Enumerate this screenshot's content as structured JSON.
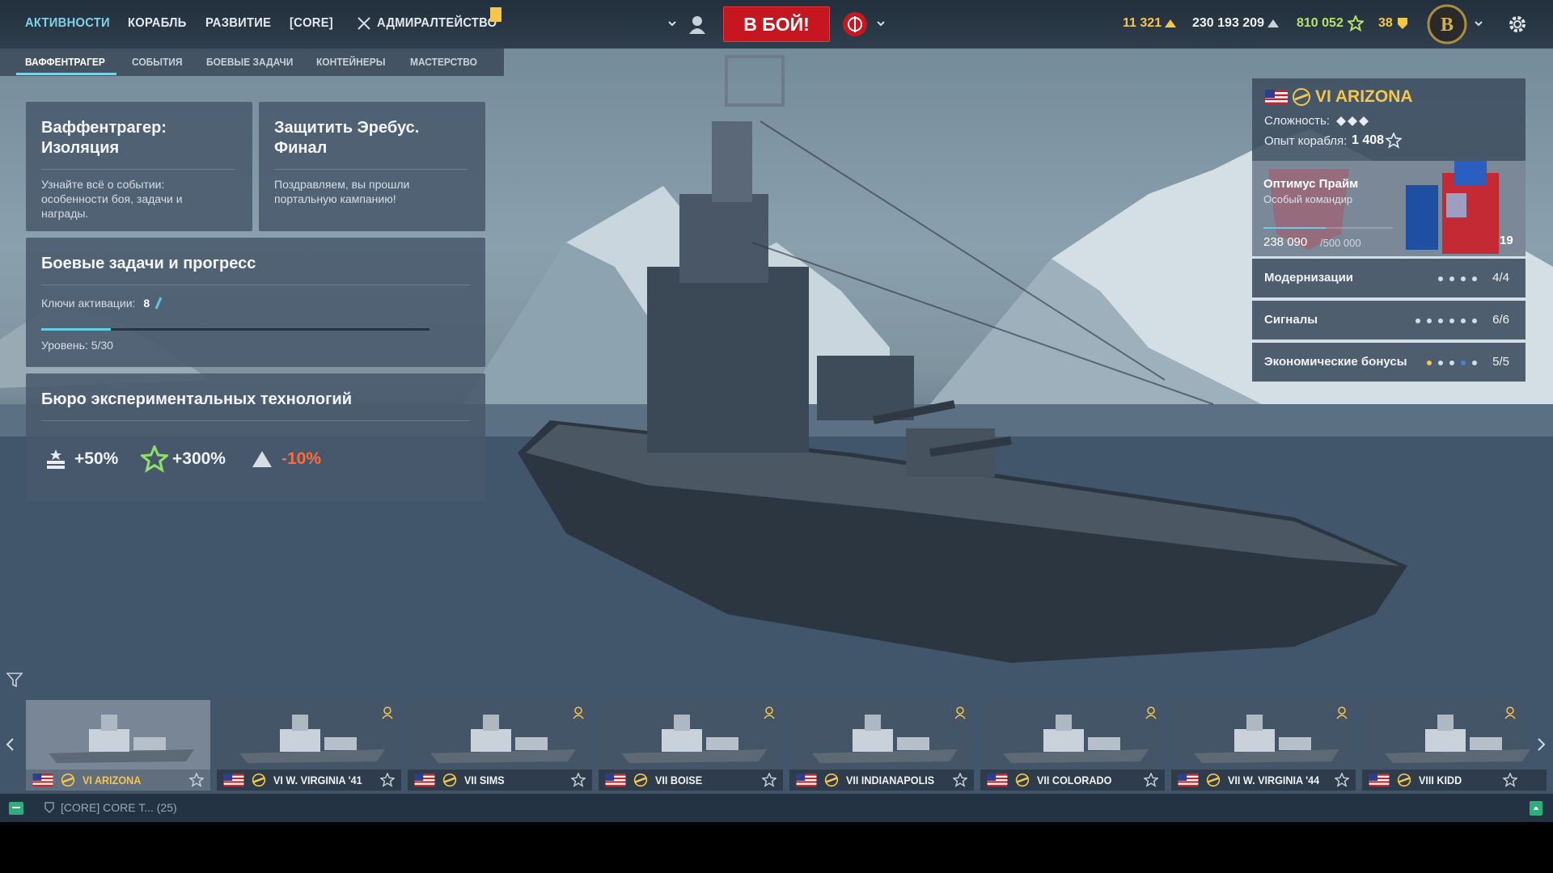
{
  "top_nav": {
    "items": [
      {
        "label": "АКТИВНОСТИ",
        "active": true
      },
      {
        "label": "КОРАБЛЬ"
      },
      {
        "label": "РАЗВИТИЕ"
      },
      {
        "label": "[CORE]"
      },
      {
        "label": "АДМИРАЛТЕЙСТВО"
      }
    ],
    "battle_button": "В БОЙ!",
    "resources": {
      "doubloons": "11 321",
      "credits": "230 193 209",
      "free_xp": "810 052",
      "coal": "38"
    },
    "icons": [
      "crossed-swords-icon",
      "division-icon",
      "battle-mode-icon",
      "clan-emblem-icon",
      "settings-gear-icon"
    ]
  },
  "sub_tabs": [
    {
      "label": "ВАФФЕНТРАГЕР",
      "active": true
    },
    {
      "label": "СОБЫТИЯ"
    },
    {
      "label": "БОЕВЫЕ ЗАДАЧИ"
    },
    {
      "label": "КОНТЕЙНЕРЫ"
    },
    {
      "label": "МАСТЕРСТВО"
    }
  ],
  "cards": {
    "event": {
      "title": "Ваффентрагер: Изоляция",
      "text": "Узнайте всё о событии: особенности боя, задачи и награды."
    },
    "erebus": {
      "title": "Защитить Эребус. Финал",
      "text": "Поздравляем, вы прошли портальную кампанию!"
    },
    "combat_tasks": {
      "title": "Боевые задачи и прогресс",
      "keys_label": "Ключи активации:",
      "keys_value": "8",
      "level_label": "Уровень: 5/30",
      "progress": 0.18
    },
    "bureau": {
      "title": "Бюро экспериментальных технологий",
      "bonus_xp": "+50%",
      "bonus_free_xp": "+300%",
      "bonus_credits": "-10%"
    }
  },
  "ship_panel": {
    "name": "VI ARIZONA",
    "difficulty_label": "Сложность:",
    "xp_label": "Опыт корабля:",
    "xp_value": "1 408",
    "commander_name": "Оптимус Прайм",
    "commander_type": "Особый командир",
    "commander_xp": "238 090",
    "commander_xp_max": "/500 000",
    "commander_level": "19",
    "commander_progress": 0.48,
    "rows": [
      {
        "label": "Модернизации",
        "value": "4/4",
        "dots": 4
      },
      {
        "label": "Сигналы",
        "value": "6/6",
        "dots": 6
      },
      {
        "label": "Экономические бонусы",
        "value": "5/5",
        "dots": 5
      }
    ]
  },
  "carousel": {
    "ships": [
      {
        "name": "VI ARIZONA",
        "selected": true
      },
      {
        "name": "VI W. VIRGINIA '41"
      },
      {
        "name": "VII SIMS"
      },
      {
        "name": "VII BOISE"
      },
      {
        "name": "VII INDIANAPOLIS"
      },
      {
        "name": "VII COLORADO"
      },
      {
        "name": "VII W. VIRGINIA '44"
      },
      {
        "name": "VIII KIDD"
      }
    ]
  },
  "chat": {
    "text": "[CORE] CORE T... (25)"
  }
}
